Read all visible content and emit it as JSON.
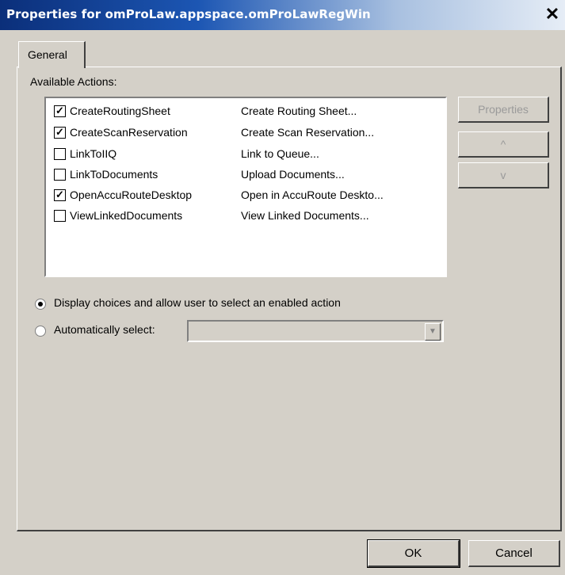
{
  "window": {
    "title": "Properties for omProLaw.appspace.omProLawRegWin",
    "close_glyph": "✕"
  },
  "tabs": [
    {
      "label": "General",
      "active": true
    }
  ],
  "available_actions": {
    "label": "Available Actions:",
    "items": [
      {
        "name": "CreateRoutingSheet",
        "description": "Create Routing Sheet...",
        "checked": true
      },
      {
        "name": "CreateScanReservation",
        "description": "Create Scan Reservation...",
        "checked": true
      },
      {
        "name": "LinkToIIQ",
        "description": "Link to Queue...",
        "checked": false
      },
      {
        "name": "LinkToDocuments",
        "description": "Upload Documents...",
        "checked": false
      },
      {
        "name": "OpenAccuRouteDesktop",
        "description": "Open in AccuRoute Deskto...",
        "checked": true
      },
      {
        "name": "ViewLinkedDocuments",
        "description": "View Linked Documents...",
        "checked": false
      }
    ]
  },
  "side_buttons": {
    "properties": "Properties",
    "up": "^",
    "down": "v"
  },
  "options": {
    "display_choices": {
      "label": "Display choices and allow user to select an enabled action",
      "selected": true
    },
    "auto_select": {
      "label": "Automatically select:",
      "selected": false,
      "value": ""
    }
  },
  "footer": {
    "ok": "OK",
    "cancel": "Cancel"
  },
  "colors": {
    "title_start": "#0b2f7a",
    "title_end": "#e6edf6",
    "face": "#d4d0c8"
  }
}
